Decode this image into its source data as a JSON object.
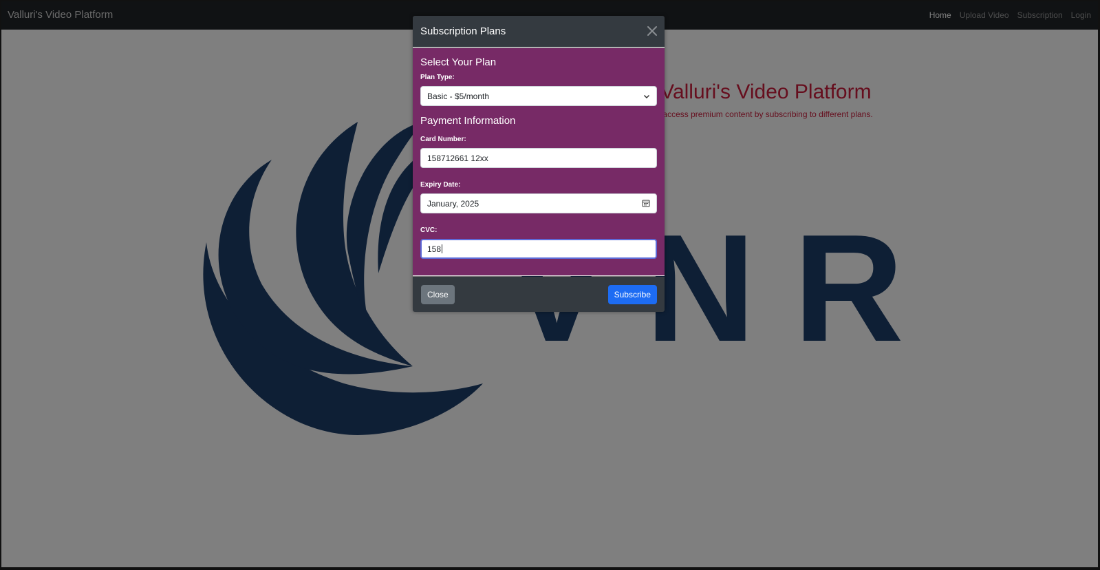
{
  "navbar": {
    "brand": "Valluri's Video Platform",
    "links": [
      "Home",
      "Upload Video",
      "Subscription",
      "Login"
    ],
    "active": "Home"
  },
  "hero": {
    "title": "Welcome to Valluri's Video Platform",
    "subtitle": "Upload, stream videos, and access premium content by subscribing to different plans."
  },
  "logo": {
    "text": "VNR",
    "color": "#1d3e6b"
  },
  "modal": {
    "title": "Subscription Plans",
    "plan_section": "Select Your Plan",
    "plan_label": "Plan Type:",
    "plan_value": "Basic - $5/month",
    "payment_section": "Payment Information",
    "card_label": "Card Number:",
    "card_value": "158712661 12xx",
    "expiry_label": "Expiry Date:",
    "expiry_value": "January, 2025",
    "cvc_label": "CVC:",
    "cvc_value": "158",
    "close_label": "Close",
    "subscribe_label": "Subscribe"
  },
  "colors": {
    "navbar": "#212529",
    "modal_header": "#343a40",
    "modal_body": "#772a66",
    "primary": "#1d6cf3",
    "secondary": "#6c757d",
    "hero_text": "#cc1d3c"
  }
}
